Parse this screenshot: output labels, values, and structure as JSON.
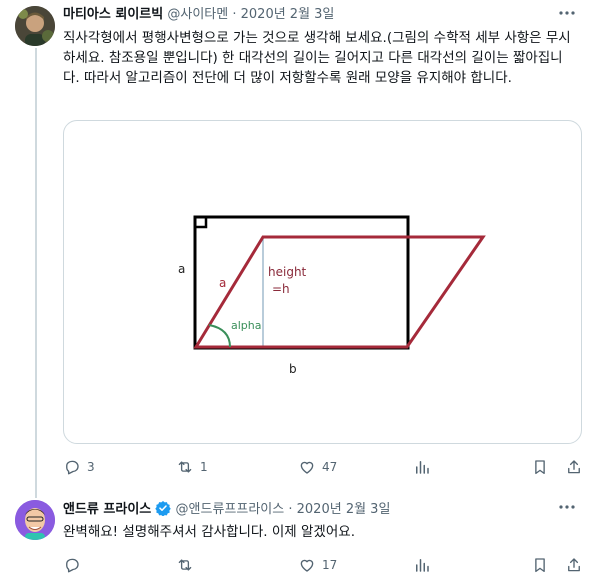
{
  "tweet1": {
    "author_name": "마티아스 뢰이르빅",
    "handle": "@사이타멘",
    "separator": "·",
    "date": "2020년 2월 3일",
    "text": "직사각형에서 평행사변형으로 가는 것으로 생각해 보세요.(그림의 수학적 세부 사항은 무시하세요. 참조용일 뿐입니다) 한 대각선의 길이는 길어지고 다른 대각선의 길이는 짧아집니다. 따라서 알고리즘이 전단에 더 많이 저항할수록 원래 모양을 유지해야 합니다.",
    "figure": {
      "label_a_left": "a",
      "label_a_slant": "a",
      "label_height": "height",
      "label_eq_h": "=h",
      "label_alpha": "alpha",
      "label_b": "b",
      "colors": {
        "rectangle": "#000000",
        "parallelogram": "#a52a3a",
        "alpha_arc": "#3a8f5a",
        "height_line": "#8aaac0"
      }
    },
    "actions": {
      "replies": "3",
      "retweets": "1",
      "likes": "47"
    }
  },
  "tweet2": {
    "author_name": "앤드류 프라이스",
    "handle": "@앤드류프프라이스",
    "separator": "·",
    "date": "2020년 2월 3일",
    "text": "완벽해요! 설명해주셔서 감사합니다. 이제 알겠어요.",
    "verified_color": "#1d9bf0",
    "actions": {
      "replies": "",
      "retweets": "",
      "likes": "17"
    }
  },
  "icons": [
    "more-icon",
    "reply-icon",
    "retweet-icon",
    "like-icon",
    "views-icon",
    "bookmark-icon",
    "share-icon",
    "verified-badge-icon"
  ]
}
